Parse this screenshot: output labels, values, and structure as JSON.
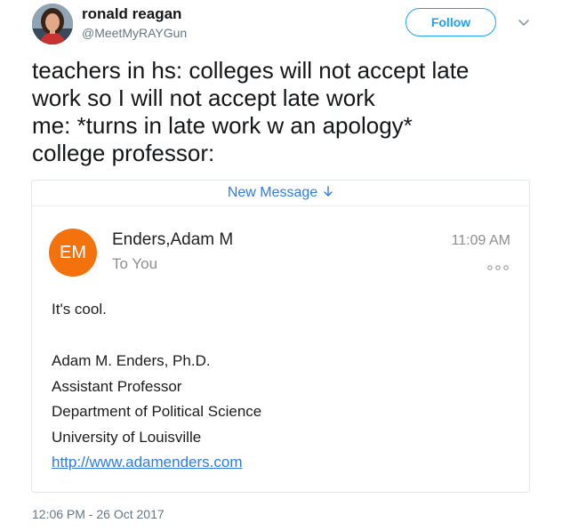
{
  "tweet": {
    "author": {
      "display_name": "ronald reagan",
      "handle": "@MeetMyRAYGun",
      "avatar_icon": "user-avatar-photo"
    },
    "follow_label": "Follow",
    "menu_icon": "chevron-down-icon",
    "text_lines": [
      "teachers in hs: colleges will not accept late",
      "work so I will not accept late work",
      "me: *turns in late work w an apology*",
      "college professor:"
    ],
    "timestamp": "12:06 PM - 26 Oct 2017"
  },
  "email_card": {
    "top_bar": {
      "label": "New Message",
      "icon": "arrow-down-icon"
    },
    "sender_initials": "EM",
    "sender_name": "Enders,Adam M",
    "recipient": "To You",
    "time": "11:09 AM",
    "more_icon": "more-dots-icon",
    "body": "It's cool.",
    "signature": {
      "name": "Adam M. Enders, Ph.D.",
      "title": "Assistant Professor",
      "department": "Department of Political Science",
      "university": "University of Louisville",
      "website": "http://www.adamenders.com"
    }
  },
  "colors": {
    "twitter_blue": "#1da1f2",
    "mail_link_blue": "#2f7ce0",
    "avatar_orange": "#f4720c",
    "secondary_text": "#657786"
  }
}
